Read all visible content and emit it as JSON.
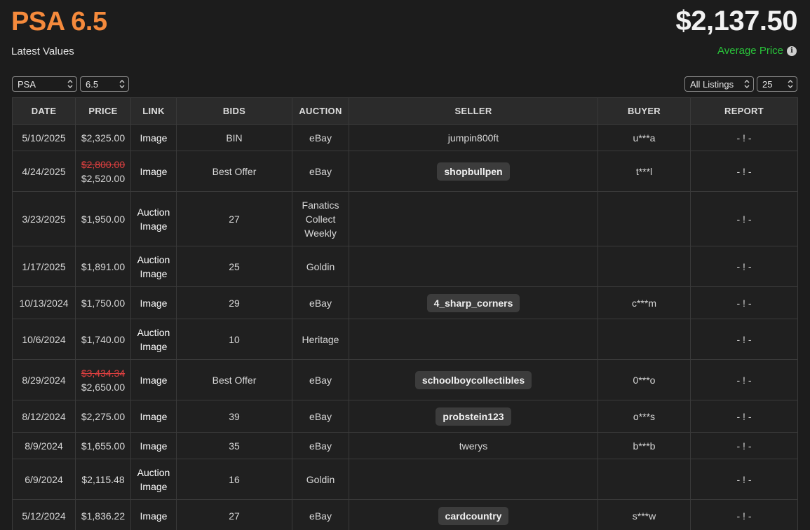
{
  "header": {
    "grade_title": "PSA 6.5",
    "subtitle": "Latest Values",
    "avg_price": "$2,137.50",
    "avg_label": "Average Price"
  },
  "filters": {
    "company": "PSA",
    "grade": "6.5",
    "listing_type": "All Listings",
    "page_size": "25"
  },
  "table": {
    "columns": [
      "DATE",
      "PRICE",
      "LINK",
      "BIDS",
      "AUCTION",
      "SELLER",
      "BUYER",
      "REPORT"
    ],
    "rows": [
      {
        "date": "5/10/2025",
        "old_price": "",
        "price": "$2,325.00",
        "link": [
          "Image"
        ],
        "bids": "BIN",
        "auction": [
          "eBay"
        ],
        "seller": "jumpin800ft",
        "seller_pill": false,
        "buyer": "u***a",
        "report": "- ! -"
      },
      {
        "date": "4/24/2025",
        "old_price": "$2,800.00",
        "price": "$2,520.00",
        "link": [
          "Image"
        ],
        "bids": "Best Offer",
        "auction": [
          "eBay"
        ],
        "seller": "shopbullpen",
        "seller_pill": true,
        "buyer": "t***l",
        "report": "- ! -"
      },
      {
        "date": "3/23/2025",
        "old_price": "",
        "price": "$1,950.00",
        "link": [
          "Auction",
          "Image"
        ],
        "bids": "27",
        "auction": [
          "Fanatics",
          "Collect",
          "Weekly"
        ],
        "seller": "",
        "seller_pill": false,
        "buyer": "",
        "report": "- ! -"
      },
      {
        "date": "1/17/2025",
        "old_price": "",
        "price": "$1,891.00",
        "link": [
          "Auction",
          "Image"
        ],
        "bids": "25",
        "auction": [
          "Goldin"
        ],
        "seller": "",
        "seller_pill": false,
        "buyer": "",
        "report": "- ! -"
      },
      {
        "date": "10/13/2024",
        "old_price": "",
        "price": "$1,750.00",
        "link": [
          "Image"
        ],
        "bids": "29",
        "auction": [
          "eBay"
        ],
        "seller": "4_sharp_corners",
        "seller_pill": true,
        "buyer": "c***m",
        "report": "- ! -"
      },
      {
        "date": "10/6/2024",
        "old_price": "",
        "price": "$1,740.00",
        "link": [
          "Auction",
          "Image"
        ],
        "bids": "10",
        "auction": [
          "Heritage"
        ],
        "seller": "",
        "seller_pill": false,
        "buyer": "",
        "report": "- ! -"
      },
      {
        "date": "8/29/2024",
        "old_price": "$3,434.34",
        "price": "$2,650.00",
        "link": [
          "Image"
        ],
        "bids": "Best Offer",
        "auction": [
          "eBay"
        ],
        "seller": "schoolboycollectibles",
        "seller_pill": true,
        "buyer": "0***o",
        "report": "- ! -"
      },
      {
        "date": "8/12/2024",
        "old_price": "",
        "price": "$2,275.00",
        "link": [
          "Image"
        ],
        "bids": "39",
        "auction": [
          "eBay"
        ],
        "seller": "probstein123",
        "seller_pill": true,
        "buyer": "o***s",
        "report": "- ! -"
      },
      {
        "date": "8/9/2024",
        "old_price": "",
        "price": "$1,655.00",
        "link": [
          "Image"
        ],
        "bids": "35",
        "auction": [
          "eBay"
        ],
        "seller": "twerys",
        "seller_pill": false,
        "buyer": "b***b",
        "report": "- ! -"
      },
      {
        "date": "6/9/2024",
        "old_price": "",
        "price": "$2,115.48",
        "link": [
          "Auction",
          "Image"
        ],
        "bids": "16",
        "auction": [
          "Goldin"
        ],
        "seller": "",
        "seller_pill": false,
        "buyer": "",
        "report": "- ! -"
      },
      {
        "date": "5/12/2024",
        "old_price": "",
        "price": "$1,836.22",
        "link": [
          "Image"
        ],
        "bids": "27",
        "auction": [
          "eBay"
        ],
        "seller": "cardcountry",
        "seller_pill": true,
        "buyer": "s***w",
        "report": "- ! -"
      }
    ]
  },
  "colors": {
    "accent_orange": "#f58a3c",
    "avg_green": "#29c43a",
    "strike_red": "#e04040"
  }
}
